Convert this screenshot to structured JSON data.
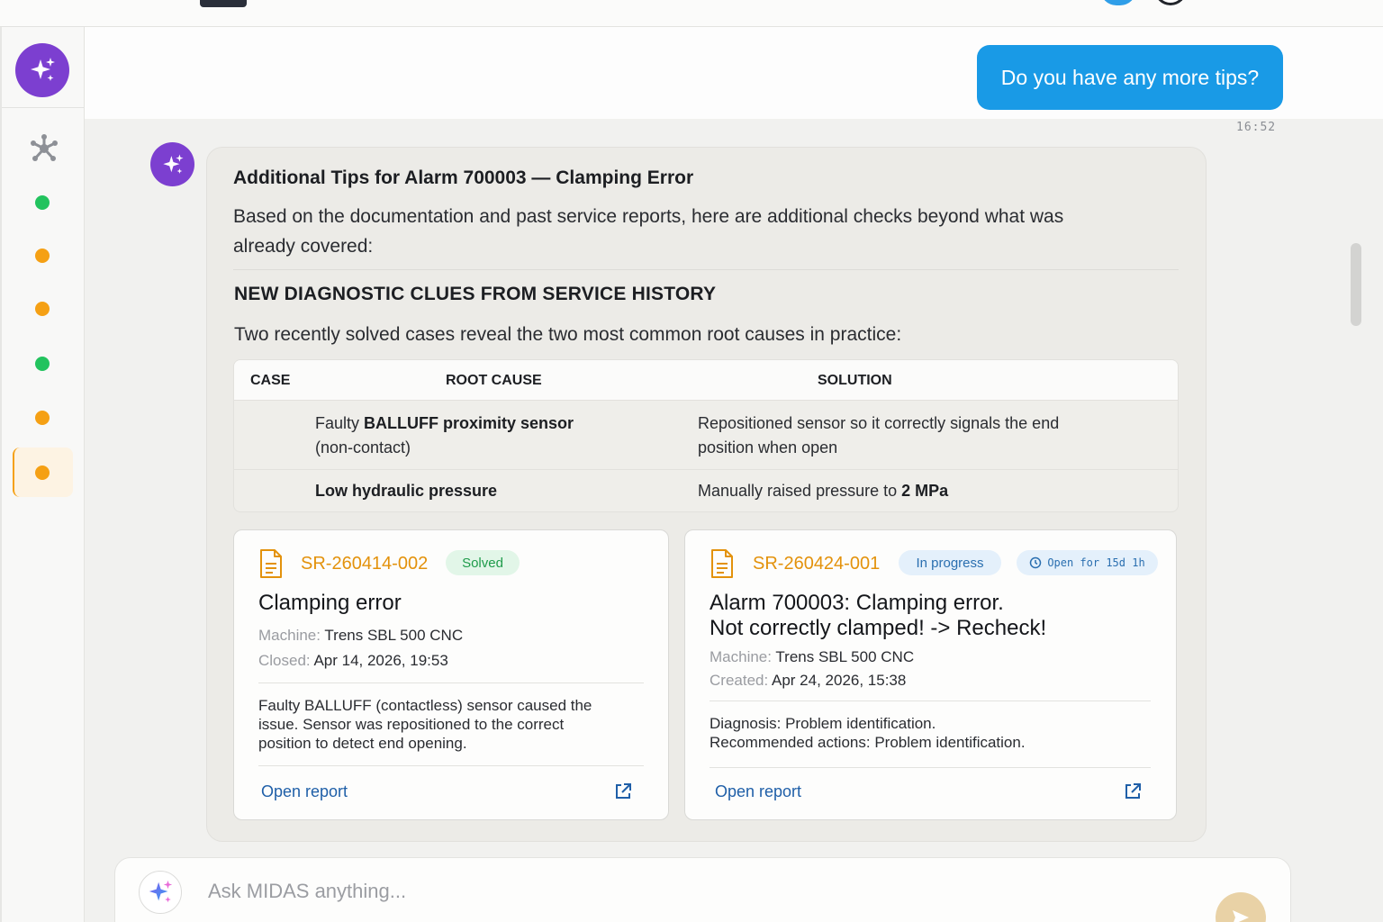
{
  "user_message": {
    "text": "Do you have any more tips?",
    "time": "16:52"
  },
  "assistant": {
    "title": "Additional Tips for Alarm 700003 — Clamping Error",
    "intro": "Based on the documentation and past service reports, here are additional checks beyond what was already covered:",
    "section_heading": "NEW DIAGNOSTIC CLUES FROM SERVICE HISTORY",
    "section_sub": "Two recently solved cases reveal the two most common root causes in practice:",
    "table": {
      "headers": [
        "CASE",
        "ROOT CAUSE",
        "SOLUTION"
      ],
      "rows": [
        {
          "case": "",
          "root_cause_prefix": "Faulty ",
          "root_cause_bold": "BALLUFF proximity sensor",
          "root_cause_suffix": "(non-contact)",
          "solution_line1": "Repositioned sensor so it correctly signals the end",
          "solution_line2": "position when open"
        },
        {
          "case": "",
          "root_cause_bold": "Low hydraulic pressure",
          "solution_prefix": "Manually raised pressure to ",
          "solution_bold": "2 MPa"
        }
      ]
    },
    "reports": [
      {
        "id": "SR-260414-002",
        "status": "Solved",
        "title": "Clamping error",
        "machine_label": "Machine:",
        "machine": "Trens SBL 500 CNC",
        "date_label": "Closed:",
        "date": "Apr 14, 2026, 19:53",
        "description": "Faulty BALLUFF (contactless) sensor caused the issue. Sensor was repositioned to the correct position to detect end opening.",
        "link": "Open report"
      },
      {
        "id": "SR-260424-001",
        "status": "In progress",
        "open_for": "Open for 15d 1h",
        "title_line1": "Alarm 700003: Clamping error.",
        "title_line2": "Not correctly clamped! -> Recheck!",
        "machine_label": "Machine:",
        "machine": "Trens SBL 500 CNC",
        "date_label": "Created:",
        "date": "Apr 24, 2026, 15:38",
        "description_line1": "Diagnosis: Problem identification.",
        "description_line2": "Recommended actions: Problem identification.",
        "link": "Open report"
      }
    ]
  },
  "composer": {
    "placeholder": "Ask MIDAS anything..."
  },
  "sidebar": {
    "status_dots": [
      "green",
      "orange",
      "orange",
      "green",
      "orange",
      "orange"
    ],
    "active_index": 5
  },
  "colors": {
    "brand_purple": "#7c3fd0",
    "user_bubble": "#199ae6",
    "report_id": "#e3920c",
    "status_green": "#22c35e",
    "status_orange": "#f5a014"
  },
  "icons": [
    "sparkle-icon",
    "hub-icon",
    "document-icon",
    "clock-icon",
    "external-link-icon",
    "send-icon"
  ]
}
